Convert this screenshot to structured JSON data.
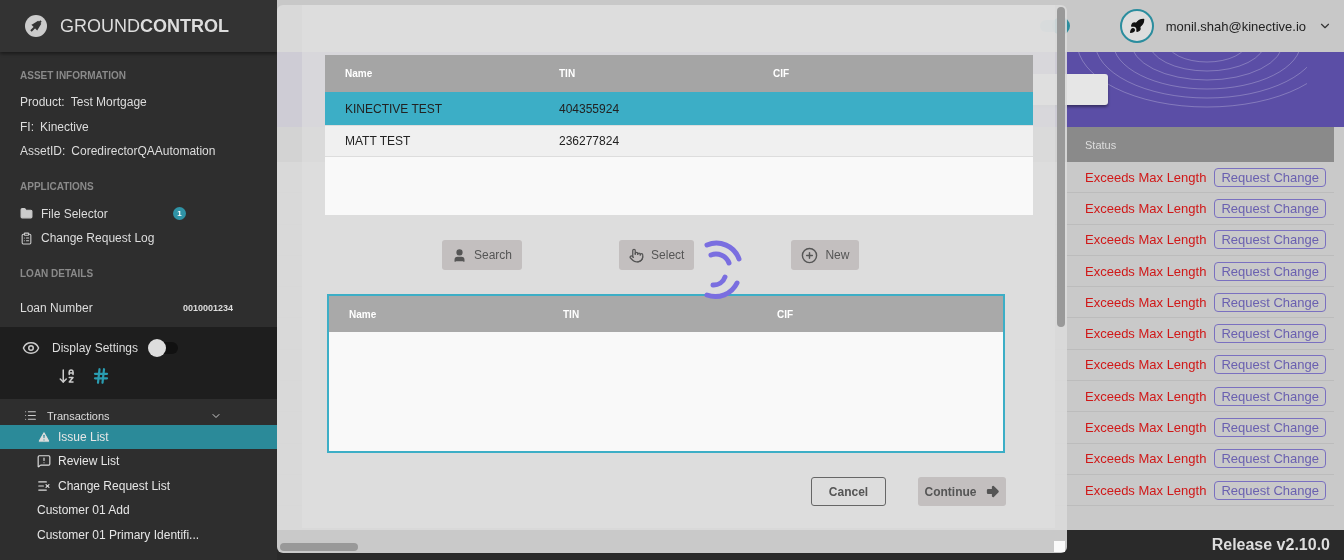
{
  "sidebar": {
    "logo": "GROUND**CONTROL**",
    "asset_section": "ASSET INFORMATION",
    "asset_info": [
      {
        "label": "Product:",
        "value": "Test Mortgage"
      },
      {
        "label": "FI:",
        "value": "Kinective"
      },
      {
        "label": "AssetID:",
        "value": "CoredirectorQAAutomation"
      }
    ],
    "applications_section": "APPLICATIONS",
    "applications": [
      {
        "kind": "folder",
        "label": "File Selector",
        "badge": "1"
      },
      {
        "kind": "clipboard",
        "label": "Change Request Log"
      }
    ],
    "loan_section": "LOAN DETAILS",
    "loan_number": {
      "label": "Loan Number",
      "value": "0010001234"
    },
    "display_settings": {
      "label": "Display Settings",
      "on": false,
      "modes": [
        {
          "kind": "alpha",
          "selected": false
        },
        {
          "kind": "numeric",
          "selected": true
        }
      ]
    },
    "nav": {
      "label": "Transactions",
      "expanded": true,
      "children": [
        {
          "kind": "warning",
          "label": "Issue List",
          "selected": true
        },
        {
          "kind": "review",
          "label": "Review List",
          "selected": false
        },
        {
          "kind": "changes",
          "label": "Change Request List",
          "selected": false
        },
        {
          "kind": "plain",
          "label": "Customer 01 Add",
          "selected": false
        },
        {
          "kind": "plain",
          "label": "Customer 01 Primary Identifi...",
          "selected": false
        }
      ]
    }
  },
  "header": {
    "implementation_mode": {
      "on": true
    },
    "user": "monil.shah@kinective.io"
  },
  "table": {
    "status_column": "Status",
    "rows": [
      {
        "status": "Exceeds Max Length",
        "action": "Request Change"
      },
      {
        "status": "Exceeds Max Length",
        "action": "Request Change"
      },
      {
        "status": "Exceeds Max Length",
        "action": "Request Change"
      },
      {
        "status": "Exceeds Max Length",
        "action": "Request Change"
      },
      {
        "status": "Exceeds Max Length",
        "action": "Request Change"
      },
      {
        "status": "Exceeds Max Length",
        "action": "Request Change"
      },
      {
        "status": "Exceeds Max Length",
        "action": "Request Change"
      },
      {
        "status": "Exceeds Max Length",
        "action": "Request Change"
      },
      {
        "status": "Exceeds Max Length",
        "action": "Request Change"
      },
      {
        "status": "Exceeds Max Length",
        "action": "Request Change"
      },
      {
        "status": "Exceeds Max Length",
        "action": "Request Change"
      }
    ]
  },
  "modal": {
    "results": {
      "columns": [
        "Name",
        "TIN",
        "CIF"
      ],
      "rows": [
        {
          "name": "KINECTIVE TEST",
          "tin": "404355924",
          "selected": true
        },
        {
          "name": "MATT TEST",
          "tin": "236277824",
          "selected": false
        }
      ]
    },
    "actions": [
      {
        "kind": "user",
        "label": "Search"
      },
      {
        "kind": "pointer",
        "label": "Select"
      },
      {
        "kind": "plus",
        "label": "New"
      }
    ],
    "chosen": {
      "columns": [
        "Name",
        "TIN",
        "CIF"
      ]
    },
    "cancel": "Cancel",
    "continue": "Continue"
  },
  "footer": {
    "release": "Release v2.10.0"
  }
}
